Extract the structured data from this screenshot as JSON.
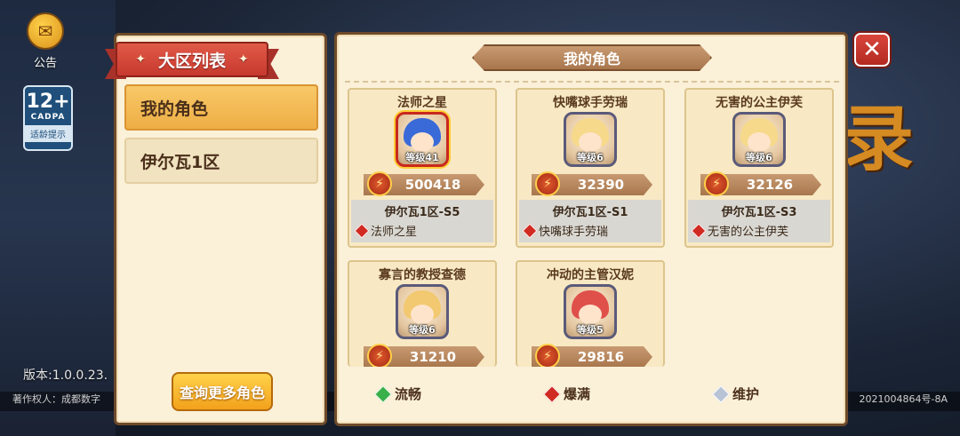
{
  "background": {
    "notice_label": "公告",
    "age_rating": {
      "number": "12+",
      "org": "CADPA",
      "tip": "适龄提示"
    },
    "version": "版本:1.0.0.23.",
    "copyright": "著作权人：成都数字",
    "license": "2021004864号-8A",
    "logo_glyph": "录"
  },
  "region_panel": {
    "title": "大区列表",
    "items": [
      {
        "label": "我的角色",
        "active": true
      },
      {
        "label": "伊尔瓦1区",
        "active": false
      }
    ],
    "query_button": "查询更多角色"
  },
  "roles_panel": {
    "title": "我的角色",
    "close_icon": "close-icon",
    "cards": [
      {
        "name": "法师之星",
        "level": "等级41",
        "power": "500418",
        "server": "伊尔瓦1区-S5",
        "role": "法师之星",
        "hair_color": "#3a6ad8",
        "special": true
      },
      {
        "name": "快嘴球手劳瑞",
        "level": "等级6",
        "power": "32390",
        "server": "伊尔瓦1区-S1",
        "role": "快嘴球手劳瑞",
        "hair_color": "#f6d98a",
        "special": false
      },
      {
        "name": "无害的公主伊芙",
        "level": "等级6",
        "power": "32126",
        "server": "伊尔瓦1区-S3",
        "role": "无害的公主伊芙",
        "hair_color": "#f6d98a",
        "special": false
      },
      {
        "name": "寡言的教授查德",
        "level": "等级6",
        "power": "31210",
        "server": "",
        "role": "",
        "hair_color": "#f2c870",
        "special": false
      },
      {
        "name": "冲动的主管汉妮",
        "level": "等级5",
        "power": "29816",
        "server": "",
        "role": "",
        "hair_color": "#e0504a",
        "special": false
      }
    ],
    "legend": [
      {
        "label": "流畅",
        "color": "green"
      },
      {
        "label": "爆满",
        "color": "red"
      },
      {
        "label": "维护",
        "color": "grey"
      }
    ]
  },
  "colors": {
    "panel_bg": "#fbf0d8",
    "panel_border": "#6e4a2a",
    "ribbon_red": "#c7392e",
    "active_item": "#eeae45",
    "button_orange": "#f3a11c"
  }
}
